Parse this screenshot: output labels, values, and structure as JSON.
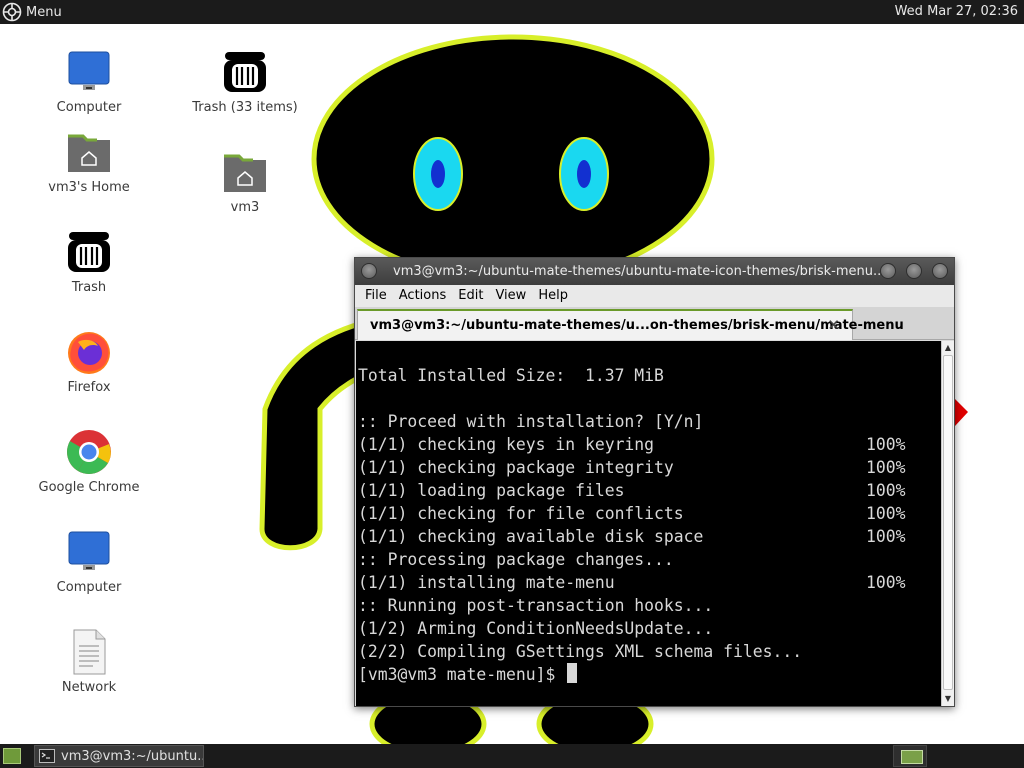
{
  "top_panel": {
    "menu_label": "Menu",
    "clock": "Wed Mar 27, 02:36"
  },
  "desktop": {
    "icons": [
      {
        "label": "Computer",
        "icon": "computer-icon"
      },
      {
        "label": "vm3's Home",
        "icon": "home-folder-icon"
      },
      {
        "label": "Trash",
        "icon": "trash-icon"
      },
      {
        "label": "Firefox",
        "icon": "firefox-icon"
      },
      {
        "label": "Google Chrome",
        "icon": "chrome-icon"
      },
      {
        "label": "Computer",
        "icon": "computer-icon"
      },
      {
        "label": "Network",
        "icon": "network-document-icon"
      },
      {
        "label": "Trash (33 items)",
        "icon": "trash-icon"
      },
      {
        "label": "vm3",
        "icon": "home-folder-icon"
      }
    ]
  },
  "terminal": {
    "title": "vm3@vm3:~/ubuntu-mate-themes/ubuntu-mate-icon-themes/brisk-menu...",
    "menu": [
      "File",
      "Actions",
      "Edit",
      "View",
      "Help"
    ],
    "tab_label": "vm3@vm3:~/ubuntu-mate-themes/u...on-themes/brisk-menu/mate-menu",
    "tab_close": "✕",
    "lines": [
      {
        "text": "",
        "pct": ""
      },
      {
        "text": "Total Installed Size:  1.37 MiB",
        "pct": ""
      },
      {
        "text": "",
        "pct": ""
      },
      {
        "text": ":: Proceed with installation? [Y/n]",
        "pct": ""
      },
      {
        "text": "(1/1) checking keys in keyring",
        "pct": "100%"
      },
      {
        "text": "(1/1) checking package integrity",
        "pct": "100%"
      },
      {
        "text": "(1/1) loading package files",
        "pct": "100%"
      },
      {
        "text": "(1/1) checking for file conflicts",
        "pct": "100%"
      },
      {
        "text": "(1/1) checking available disk space",
        "pct": "100%"
      },
      {
        "text": ":: Processing package changes...",
        "pct": ""
      },
      {
        "text": "(1/1) installing mate-menu",
        "pct": "100%"
      },
      {
        "text": ":: Running post-transaction hooks...",
        "pct": ""
      },
      {
        "text": "(1/2) Arming ConditionNeedsUpdate...",
        "pct": ""
      },
      {
        "text": "(2/2) Compiling GSettings XML schema files...",
        "pct": ""
      }
    ],
    "prompt": "[vm3@vm3 mate-menu]$ "
  },
  "bottom_panel": {
    "task_label": "vm3@vm3:~/ubuntu..."
  },
  "colors": {
    "panel": "#1b1b1b",
    "accent_green": "#6f9a3a",
    "mascot_black": "#000000",
    "mascot_outline": "#d8ef2a",
    "eye_cyan": "#1ad8f0",
    "pupil_blue": "#1230d0"
  }
}
